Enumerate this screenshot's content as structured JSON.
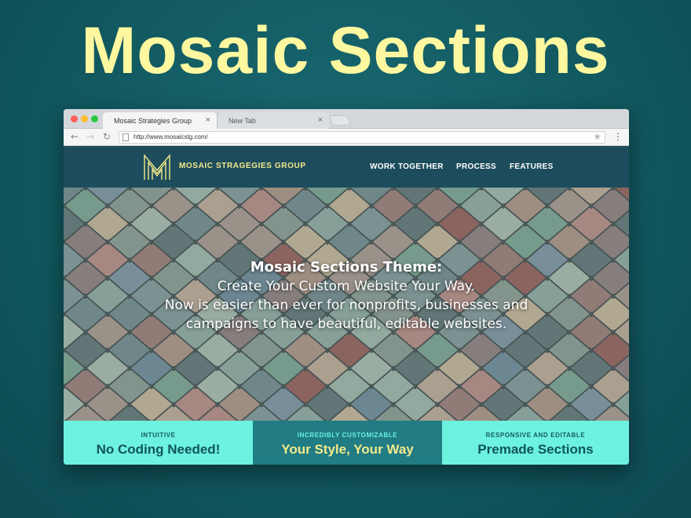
{
  "headline": "Mosaic Sections",
  "browser": {
    "tabs": [
      {
        "label": "Mosaic Strategies Group",
        "close": "×"
      },
      {
        "label": "New Tab",
        "close": "×"
      }
    ],
    "nav": {
      "back": "←",
      "forward": "→",
      "reload": "↻",
      "menu": "⋮",
      "star": "★"
    },
    "url": "http://www.mosaicstg.com/"
  },
  "site": {
    "brand": "MOSAIC STRAGEGIES GROUP",
    "menu": [
      "WORK TOGETHER",
      "PROCESS",
      "FEATURES"
    ],
    "hero": {
      "title": "Mosaic Sections Theme:",
      "lines": [
        "Create Your Custom Website Your Way.",
        "Now is easier than ever for nonprofits, businesses and",
        "campaigns to have beautiful, editable websites."
      ]
    },
    "features": [
      {
        "kicker": "INTUITIVE",
        "heading": "No Coding Needed!"
      },
      {
        "kicker": "INCREDIBLY CUSTOMIZABLE",
        "heading": "Your Style, Your Way"
      },
      {
        "kicker": "RESPONSIVE AND EDITABLE",
        "heading": "Premade Sections"
      }
    ]
  },
  "colors": {
    "background": "#125960",
    "headline": "#fdf7a0",
    "site_nav": "#1d4d5d",
    "feature_light": "#6cf2de",
    "feature_dark": "#217c84",
    "brand_gold": "#f4e98a"
  },
  "icons": [
    "back-arrow-icon",
    "forward-arrow-icon",
    "reload-icon",
    "page-icon",
    "star-icon",
    "menu-dots-icon",
    "close-tab-icon",
    "mosaic-m-logo"
  ]
}
